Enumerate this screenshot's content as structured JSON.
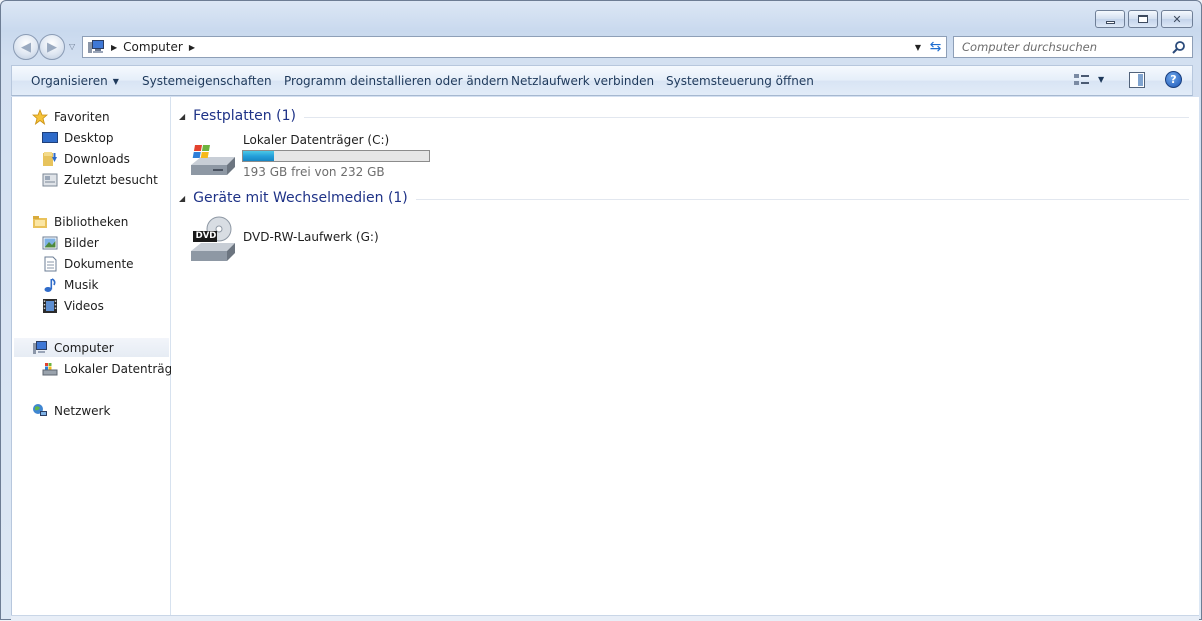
{
  "window": {
    "caption_buttons": {
      "minimize": "minimize",
      "maximize": "maximize",
      "close": "✕"
    }
  },
  "address": {
    "location": "Computer"
  },
  "search": {
    "placeholder": "Computer durchsuchen"
  },
  "toolbar": {
    "organize": "Organisieren",
    "system_properties": "Systemeigenschaften",
    "uninstall": "Programm deinstallieren oder ändern",
    "map_drive": "Netzlaufwerk verbinden",
    "control_panel": "Systemsteuerung öffnen",
    "help": "?"
  },
  "sidebar": {
    "favorites": {
      "label": "Favoriten",
      "items": [
        {
          "label": "Desktop",
          "icon": "desktop-icon"
        },
        {
          "label": "Downloads",
          "icon": "downloads-icon"
        },
        {
          "label": "Zuletzt besucht",
          "icon": "recent-places-icon"
        }
      ]
    },
    "libraries": {
      "label": "Bibliotheken",
      "items": [
        {
          "label": "Bilder",
          "icon": "pictures-icon"
        },
        {
          "label": "Dokumente",
          "icon": "documents-icon"
        },
        {
          "label": "Musik",
          "icon": "music-icon"
        },
        {
          "label": "Videos",
          "icon": "videos-icon"
        }
      ]
    },
    "computer": {
      "label": "Computer",
      "items": [
        {
          "label": "Lokaler Datenträger",
          "icon": "drive-icon"
        }
      ]
    },
    "network": {
      "label": "Netzwerk"
    }
  },
  "main": {
    "groups": [
      {
        "title": "Festplatten (1)",
        "drives": [
          {
            "name": "Lokaler Datenträger (C:)",
            "free_text": "193 GB frei von 232 GB",
            "used_fraction": 0.168
          }
        ]
      },
      {
        "title": "Geräte mit Wechselmedien (1)",
        "drives": [
          {
            "name": "DVD-RW-Laufwerk (G:)",
            "badge": "DVD"
          }
        ]
      }
    ]
  },
  "colors": {
    "accent": "#1e3287",
    "progress": "#26a0da"
  }
}
